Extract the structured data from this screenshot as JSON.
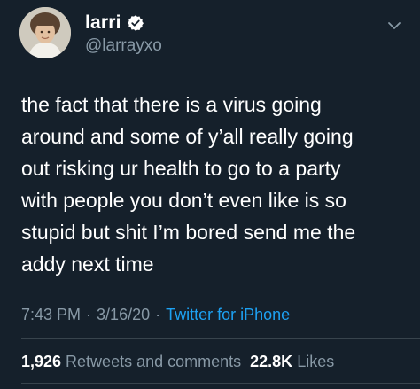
{
  "user": {
    "display_name": "larri",
    "handle": "@larrayxo",
    "verified": true,
    "avatar_icon": "profile-photo"
  },
  "tweet": {
    "text": "the fact that there is a virus going\naround and some of y’all really going\nout risking ur health to go to a party\nwith people you don’t even like is so\nstupid but shit I’m bored send me the\naddy next time"
  },
  "meta": {
    "time": "7:43 PM",
    "separator": "·",
    "date": "3/16/20",
    "source": "Twitter for iPhone"
  },
  "stats": {
    "retweets_count": "1,926",
    "retweets_label": "Retweets and comments",
    "likes_count": "22.8K",
    "likes_label": "Likes"
  },
  "colors": {
    "background": "#15202b",
    "secondary_text": "#8899a6",
    "accent": "#1da1f2",
    "divider": "#38444d"
  },
  "icons": {
    "verified": "verified-badge-icon",
    "menu": "chevron-down-icon"
  }
}
